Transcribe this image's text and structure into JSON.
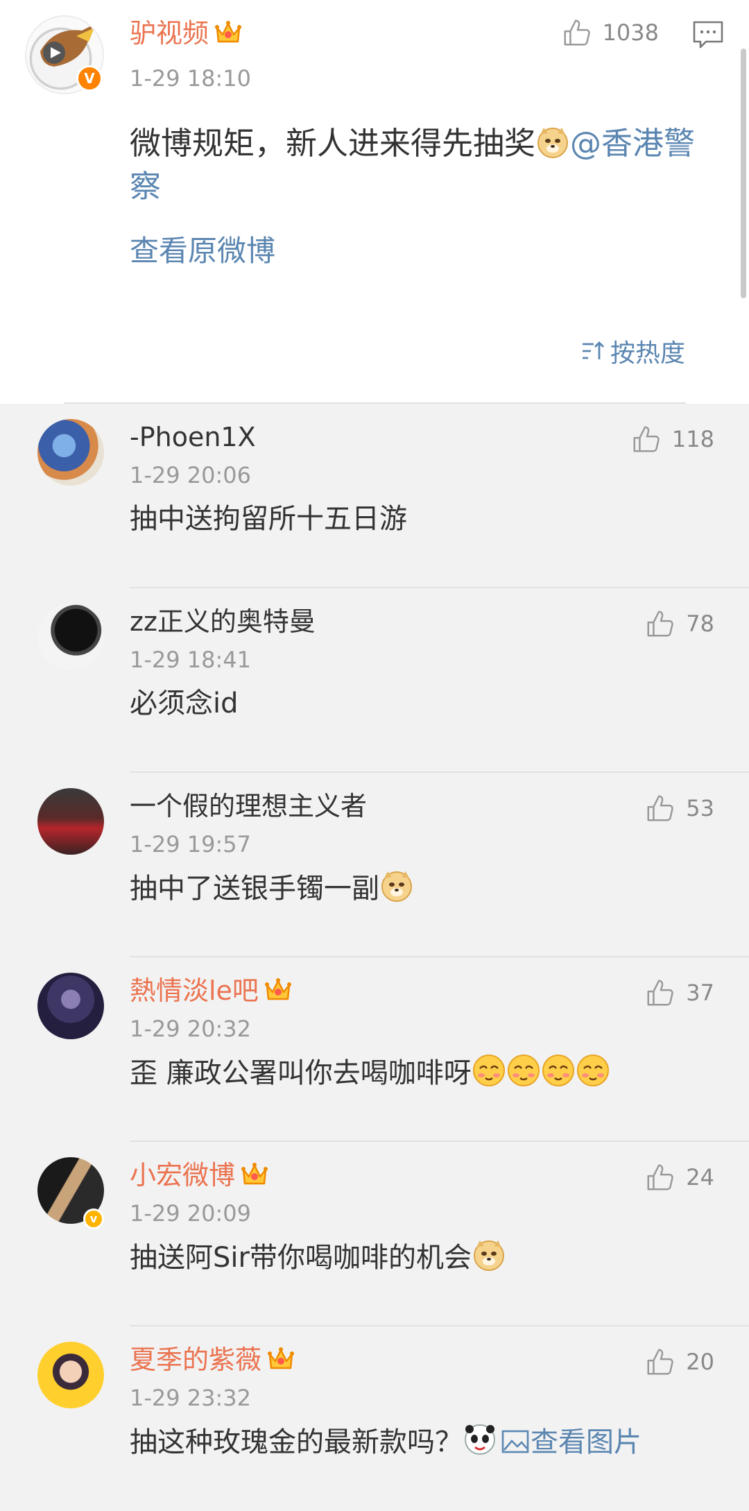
{
  "post": {
    "author": "驴视频",
    "time": "1-29 18:10",
    "like_count": "1038",
    "text_main": "微博规矩，新人进来得先抽奖",
    "mention": "@香港警察",
    "view_original": "查看原微博",
    "sort_label": "按热度"
  },
  "comments": [
    {
      "name": "-Phoen1X",
      "time": "1-29 20:06",
      "likes": "118",
      "text": "抽中送拘留所十五日游",
      "vip": false
    },
    {
      "name": "zz正义的奥特曼",
      "time": "1-29 18:41",
      "likes": "78",
      "text": "必须念id",
      "vip": false
    },
    {
      "name": "一个假的理想主义者",
      "time": "1-29 19:57",
      "likes": "53",
      "text": "抽中了送银手镯一副",
      "vip": false
    },
    {
      "name": "熱情淡le吧",
      "time": "1-29 20:32",
      "likes": "37",
      "text": "歪 廉政公署叫你去喝咖啡呀",
      "vip": true
    },
    {
      "name": "小宏微博",
      "time": "1-29 20:09",
      "likes": "24",
      "text": "抽送阿Sir带你喝咖啡的机会",
      "vip": true
    },
    {
      "name": "夏季的紫薇",
      "time": "1-29 23:32",
      "likes": "20",
      "text": "抽这种玫瑰金的最新款吗？",
      "vip": true,
      "link": "查看图片"
    }
  ],
  "colors": {
    "accent_orange": "#eb7350",
    "link_blue": "#5b86b1",
    "vip_badge": "#ff8200"
  },
  "icons": [
    "thumbs-up-icon",
    "comment-icon",
    "crown-icon",
    "verified-badge",
    "sort-icon",
    "image-icon",
    "doge-emoji",
    "shy-emoji"
  ]
}
